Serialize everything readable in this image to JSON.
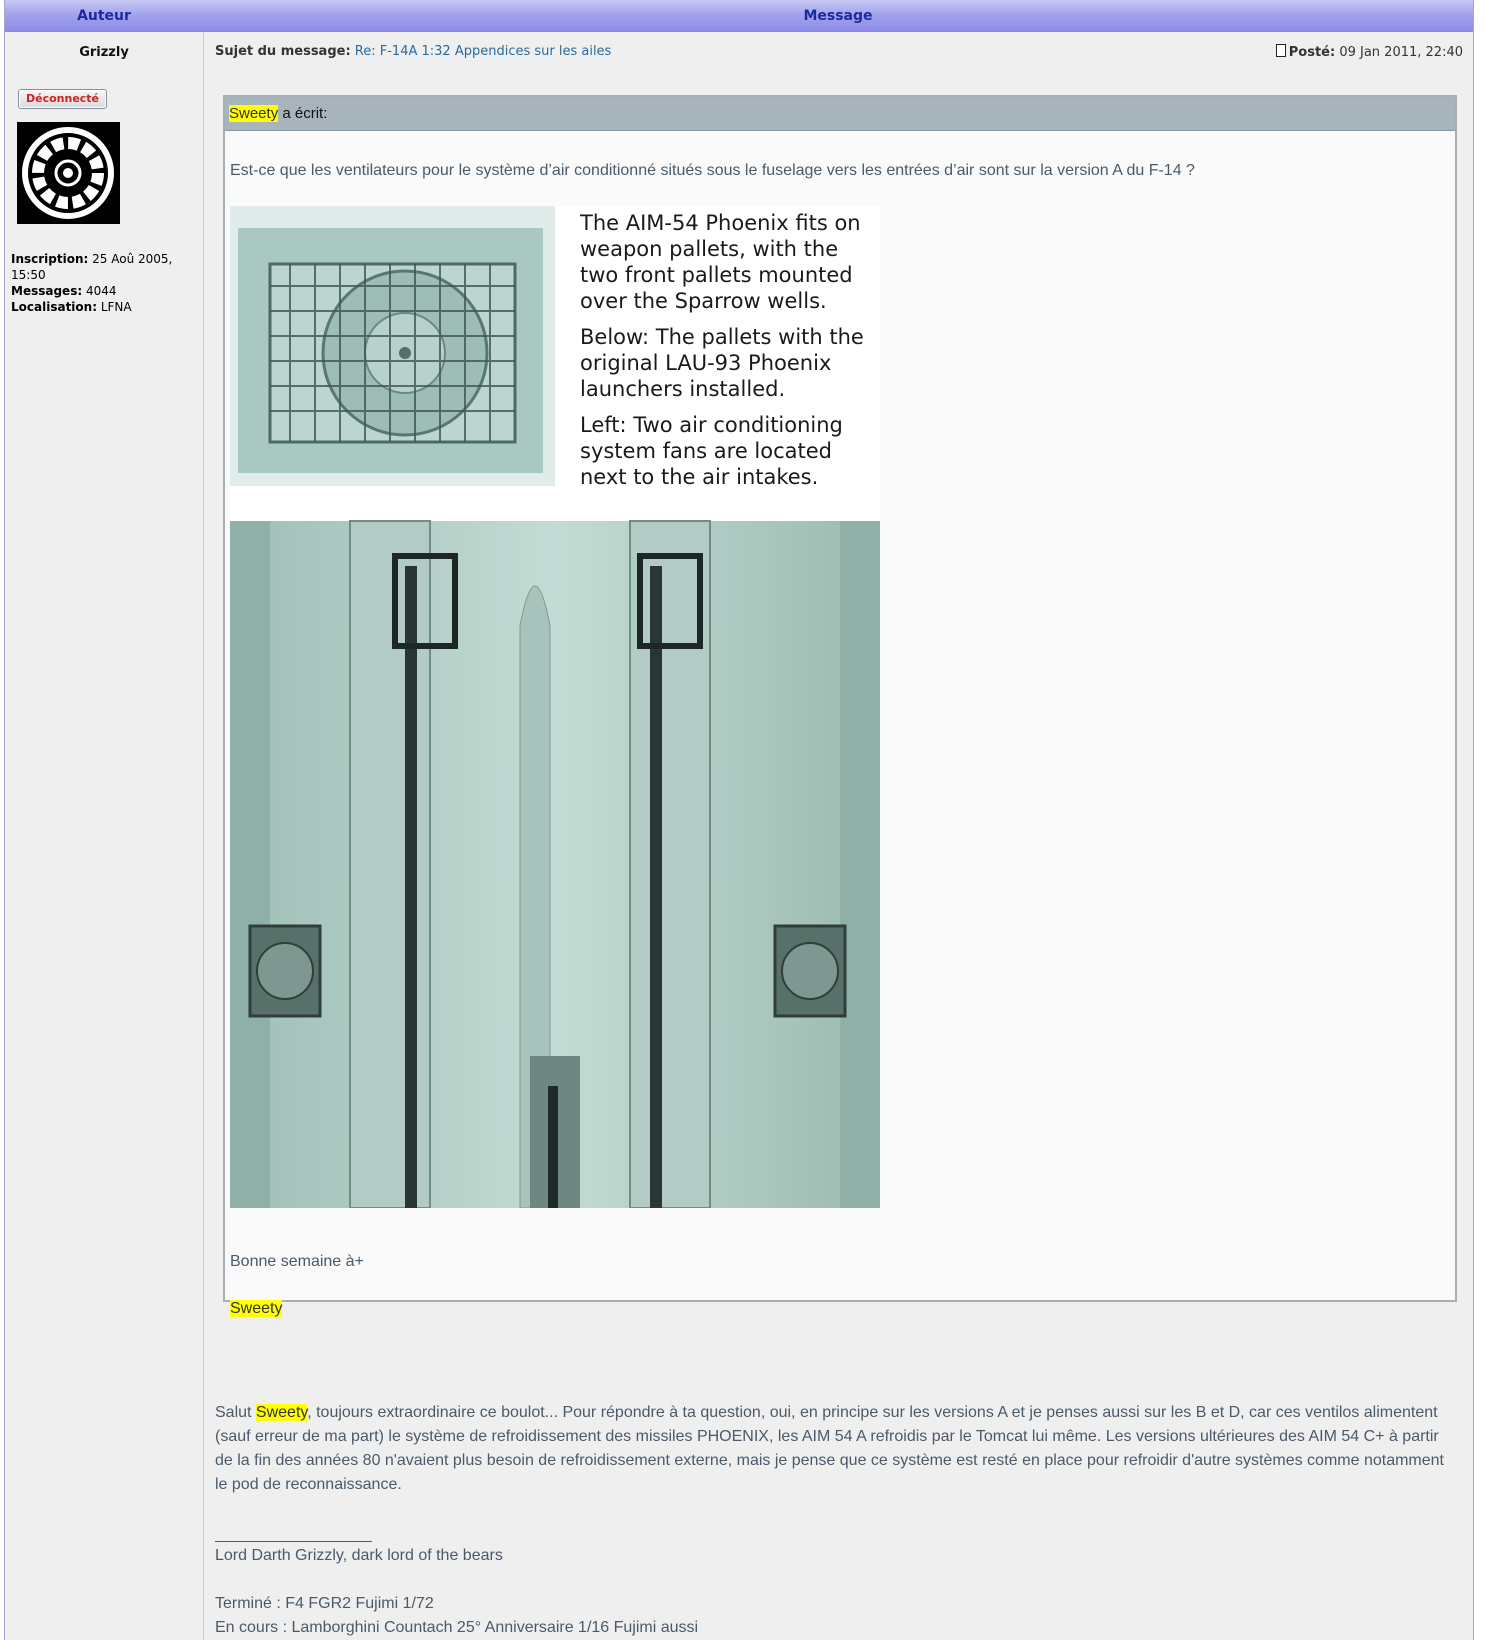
{
  "header": {
    "author_col": "Auteur",
    "message_col": "Message"
  },
  "author": {
    "username": "Grizzly",
    "status_badge": "Déconnecté",
    "avatar_icon": "galactic-empire-emblem-icon",
    "inscription_label": "Inscription:",
    "inscription_value": "25 Aoû 2005, 15:50",
    "messages_label": "Messages:",
    "messages_value": "4044",
    "location_label": "Localisation:",
    "location_value": "LFNA"
  },
  "post": {
    "subject_label": "Sujet du message:",
    "subject_value": "Re: F-14A 1:32 Appendices sur les ailes",
    "posted_label": "Posté:",
    "posted_value": "09 Jan 2011, 22:40",
    "post_icon": "document-icon"
  },
  "quote": {
    "author": "Sweety",
    "wrote": " a écrit:",
    "text": "Est-ce que les ventilateurs pour le système d’air conditionné situés sous le fuselage vers les entrées d’air sont sur la version A du F-14 ?",
    "image_caption": [
      "The AIM-54 Phoenix fits on weapon pallets, with the two front pallets mounted over the Sparrow wells.",
      "Below: The pallets with the original LAU-93 Phoenix launchers installed.",
      "Left: Two air conditioning system fans are located next to the air intakes."
    ],
    "closing": "Bonne semaine à+",
    "signature": "Sweety"
  },
  "reply": {
    "greeting": "Salut ",
    "mention": "Sweety",
    "body": ", toujours extraordinaire ce boulot... Pour répondre à ta question, oui, en principe sur les versions A et je penses aussi sur les B et D, car ces ventilos alimentent (sauf erreur de ma part) le système de refroidissement des missiles PHOENIX, les AIM 54 A refroidis par le Tomcat lui même. Les versions ultérieures des AIM 54 C+ à partir de la fin des années 80 n'avaient plus besoin de refroidissement externe, mais je pense que ce système est resté en place pour refroidir d'autre systèmes comme notamment le pod de reconnaissance."
  },
  "signature": {
    "line1": "Lord Darth Grizzly, dark lord of the bears",
    "line2": "Terminé : F4 FGR2 Fujimi 1/72",
    "line3": "En cours : Lamborghini Countach 25° Anniversaire 1/16 Fujimi aussi"
  }
}
